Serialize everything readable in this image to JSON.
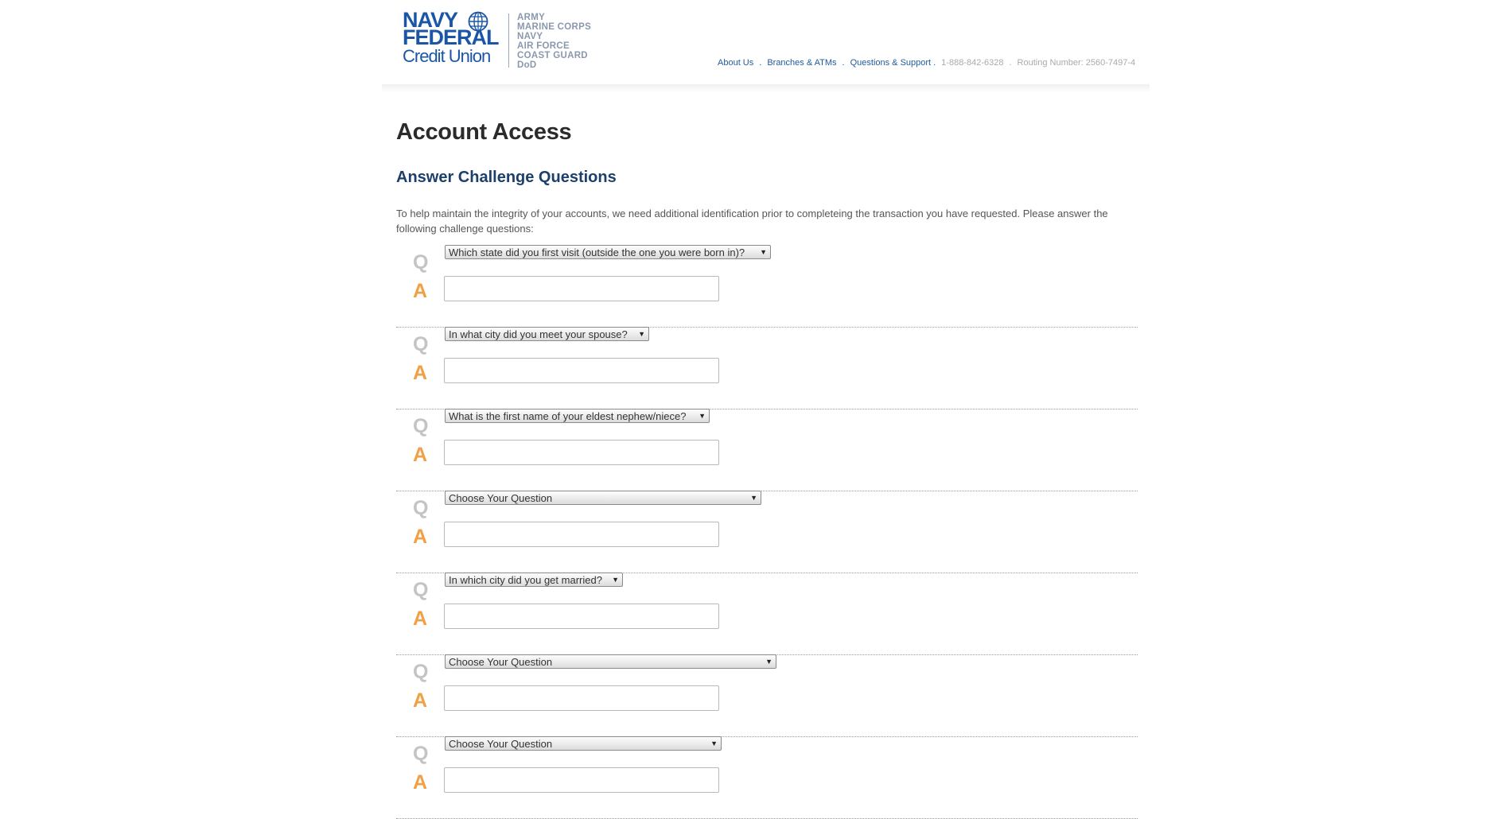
{
  "logo": {
    "line1": "NAVY",
    "line2": "FEDERAL",
    "line3": "Credit Union",
    "branches": [
      "ARMY",
      "MARINE CORPS",
      "NAVY",
      "AIR FORCE",
      "COAST GUARD",
      "DoD"
    ]
  },
  "topnav": {
    "about": "About Us",
    "branches_atms": "Branches & ATMs",
    "support": "Questions & Support",
    "phone": "1-888-842-6328",
    "routing": "Routing Number: 2560-7497-4",
    "sep": "."
  },
  "page": {
    "title": "Account Access",
    "section_title": "Answer Challenge Questions",
    "intro": "To help maintain the integrity of your accounts, we need additional identification prior to completeing the transaction you have requested. Please answer the following challenge questions:"
  },
  "qa": {
    "q_label": "Q",
    "a_label": "A",
    "dropdown_glyph": "▼",
    "items": [
      {
        "question": "Which state did you first visit (outside the one you were born in)?",
        "answer": ""
      },
      {
        "question": "In what city did you meet your spouse?",
        "answer": ""
      },
      {
        "question": "What is the first name of your eldest nephew/niece?",
        "answer": ""
      },
      {
        "question": "Choose Your Question",
        "answer": ""
      },
      {
        "question": "In which city did you get married?",
        "answer": ""
      },
      {
        "question": "Choose Your Question",
        "answer": ""
      },
      {
        "question": "Choose Your Question",
        "answer": ""
      }
    ]
  },
  "colors": {
    "brand_blue": "#1a55a6",
    "heading_navy": "#1d3f6b",
    "answer_orange": "#f0a045",
    "question_gray": "#c4c4c4"
  }
}
